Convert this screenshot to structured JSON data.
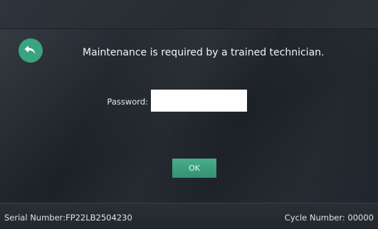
{
  "screen": {
    "message": "Maintenance is required by a trained technician.",
    "back_icon": "undo-arrow-icon"
  },
  "password": {
    "label": "Password:",
    "value": ""
  },
  "ok_button": {
    "label": "OK"
  },
  "status_bar": {
    "serial": "Serial Number:FP22LB2504230",
    "cycle": "Cycle Number: 00000"
  },
  "colors": {
    "accent": "#3aa37f",
    "background": "#20262d"
  }
}
